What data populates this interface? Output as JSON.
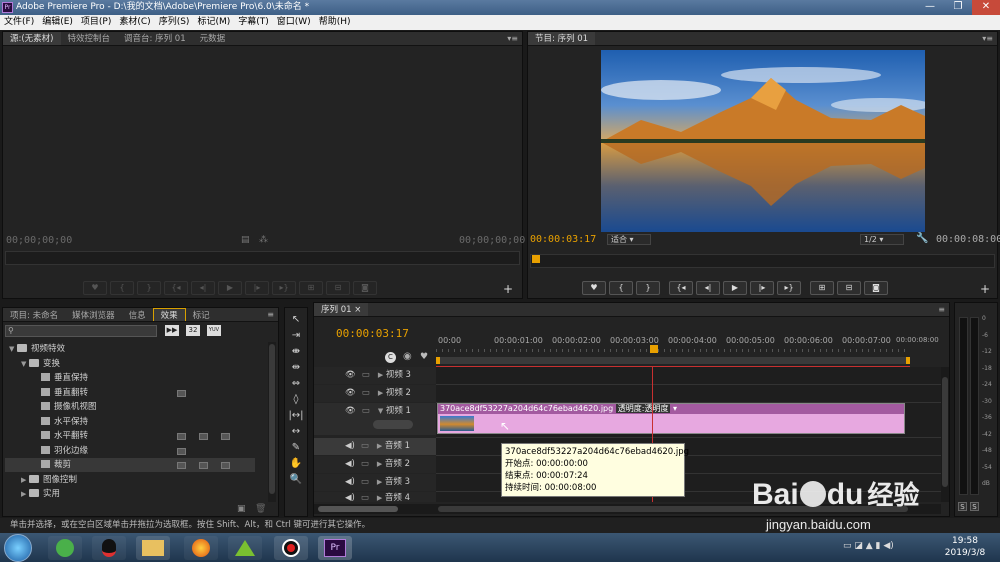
{
  "window": {
    "title": "Adobe Premiere Pro - D:\\我的文档\\Adobe\\Premiere Pro\\6.0\\未命名 *",
    "app_icon": "Pr"
  },
  "menu": [
    "文件(F)",
    "编辑(E)",
    "项目(P)",
    "素材(C)",
    "序列(S)",
    "标记(M)",
    "字幕(T)",
    "窗口(W)",
    "帮助(H)"
  ],
  "source_panel": {
    "tabs": [
      "源:(无素材)",
      "特效控制台",
      "调音台: 序列 01",
      "元数据"
    ],
    "timecode_left": "00;00;00;00",
    "timecode_right": "00;00;00;00"
  },
  "program_panel": {
    "tab": "节目: 序列 01",
    "timecode": "00:00:03:17",
    "fit": "适合",
    "resolution": "1/2",
    "duration": "00:00:08:00"
  },
  "project_panel": {
    "tabs": [
      "项目: 未命名",
      "媒体浏览器",
      "信息",
      "效果",
      "标记"
    ],
    "search_placeholder": "",
    "filter_labels": [
      "32",
      "YUV"
    ],
    "items": [
      {
        "label": "视频特效",
        "type": "folder",
        "level": 0,
        "expanded": true
      },
      {
        "label": "变换",
        "type": "folder",
        "level": 1,
        "expanded": true
      },
      {
        "label": "垂直保持",
        "type": "effect",
        "level": 2,
        "badges": 0
      },
      {
        "label": "垂直翻转",
        "type": "effect",
        "level": 2,
        "badges": 1
      },
      {
        "label": "摄像机视图",
        "type": "effect",
        "level": 2,
        "badges": 0
      },
      {
        "label": "水平保持",
        "type": "effect",
        "level": 2,
        "badges": 0
      },
      {
        "label": "水平翻转",
        "type": "effect",
        "level": 2,
        "badges": 3
      },
      {
        "label": "羽化边缘",
        "type": "effect",
        "level": 2,
        "badges": 1
      },
      {
        "label": "裁剪",
        "type": "effect",
        "level": 2,
        "badges": 3
      },
      {
        "label": "图像控制",
        "type": "folder",
        "level": 1,
        "expanded": false
      },
      {
        "label": "实用",
        "type": "folder",
        "level": 1,
        "expanded": false
      }
    ]
  },
  "sequence_panel": {
    "tab": "序列 01",
    "timecode": "00:00:03:17",
    "ruler": [
      "00:00",
      "00:00:01:00",
      "00:00:02:00",
      "00:00:03:00",
      "00:00:04:00",
      "00:00:05:00",
      "00:00:06:00",
      "00:00:07:00",
      "00:00:08:00"
    ],
    "tracks": [
      "视频 3",
      "视频 2",
      "视频 1",
      "音频 1",
      "音频 2",
      "音频 3",
      "音频 4"
    ],
    "clip": {
      "name": "370ace8df53227a204d64c76ebad4620.jpg",
      "prop": "透明度:透明度",
      "color": "#e7a8e0"
    },
    "tooltip": {
      "name": "370ace8df53227a204d64c76ebad4620.jpg",
      "start": "开始点: 00:00:00:00",
      "end": "结束点: 00:00:07:24",
      "duration": "持续时间: 00:00:08:00"
    }
  },
  "vu_meter": {
    "labels": [
      "0",
      "-6",
      "-12",
      "-18",
      "-24",
      "-30",
      "-36",
      "-42",
      "-48",
      "-54",
      "dB"
    ],
    "solo": [
      "S",
      "S"
    ]
  },
  "status_bar": "单击并选择，或在空白区域单击并拖拉为选取框。按住 Shift、Alt，和 Ctrl 键可进行其它操作。",
  "taskbar": {
    "time": "19:58",
    "date": "2019/3/8"
  },
  "watermark": {
    "brand": "Bai",
    "brand2": "du",
    "suffix": "经验",
    "url": "jingyan.baidu.com"
  }
}
